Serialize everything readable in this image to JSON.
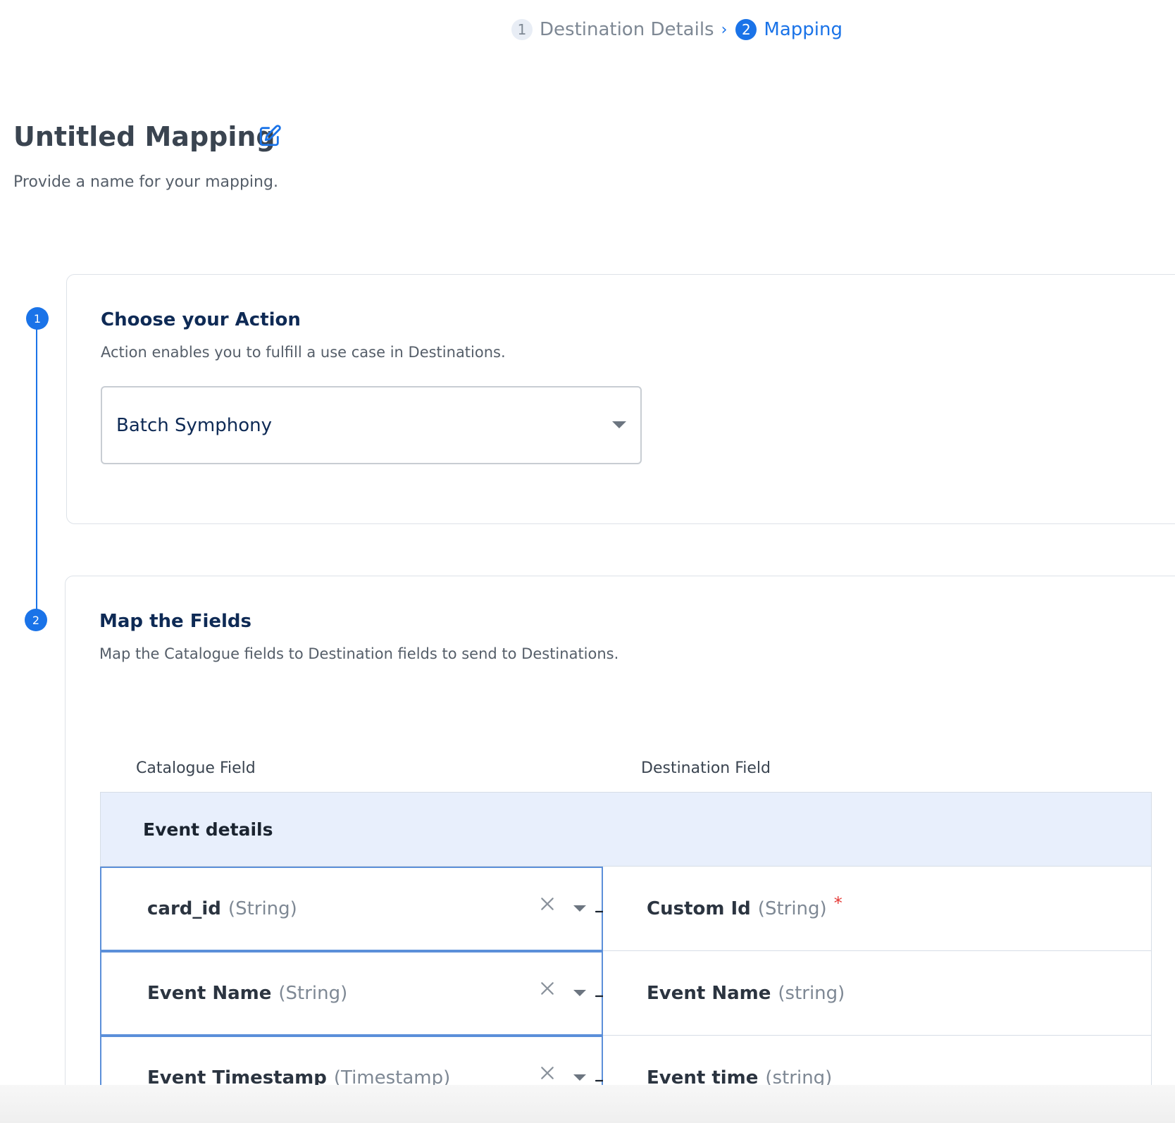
{
  "stepper": {
    "steps": [
      {
        "num": "1",
        "label": "Destination Details",
        "state": "inactive"
      },
      {
        "num": "2",
        "label": "Mapping",
        "state": "active"
      }
    ]
  },
  "header": {
    "title": "Untitled Mapping",
    "subtitle": "Provide a name for your mapping."
  },
  "timeline": {
    "step1": "1",
    "step2": "2"
  },
  "action_card": {
    "title": "Choose your Action",
    "subtitle": "Action enables you to fulfill a use case in Destinations.",
    "selected_action": "Batch Symphony"
  },
  "fields_card": {
    "title": "Map the Fields",
    "subtitle": "Map the Catalogue fields to Destination fields to send to Destinations.",
    "columns": {
      "source": "Catalogue Field",
      "destination": "Destination Field"
    },
    "group_label": "Event details",
    "rows": [
      {
        "src_name": "card_id",
        "src_type": "(String)",
        "dst_name": "Custom Id",
        "dst_type": "(String)",
        "required": "*"
      },
      {
        "src_name": "Event Name",
        "src_type": "(String)",
        "dst_name": "Event Name",
        "dst_type": "(string)",
        "required": ""
      },
      {
        "src_name": "Event Timestamp",
        "src_type": "(Timestamp)",
        "dst_name": "Event time",
        "dst_type": "(string)",
        "required": ""
      }
    ]
  },
  "colors": {
    "accent": "#1a73e8",
    "group_bg": "#e8effc",
    "heading": "#0e2a55",
    "required": "#e53935"
  }
}
